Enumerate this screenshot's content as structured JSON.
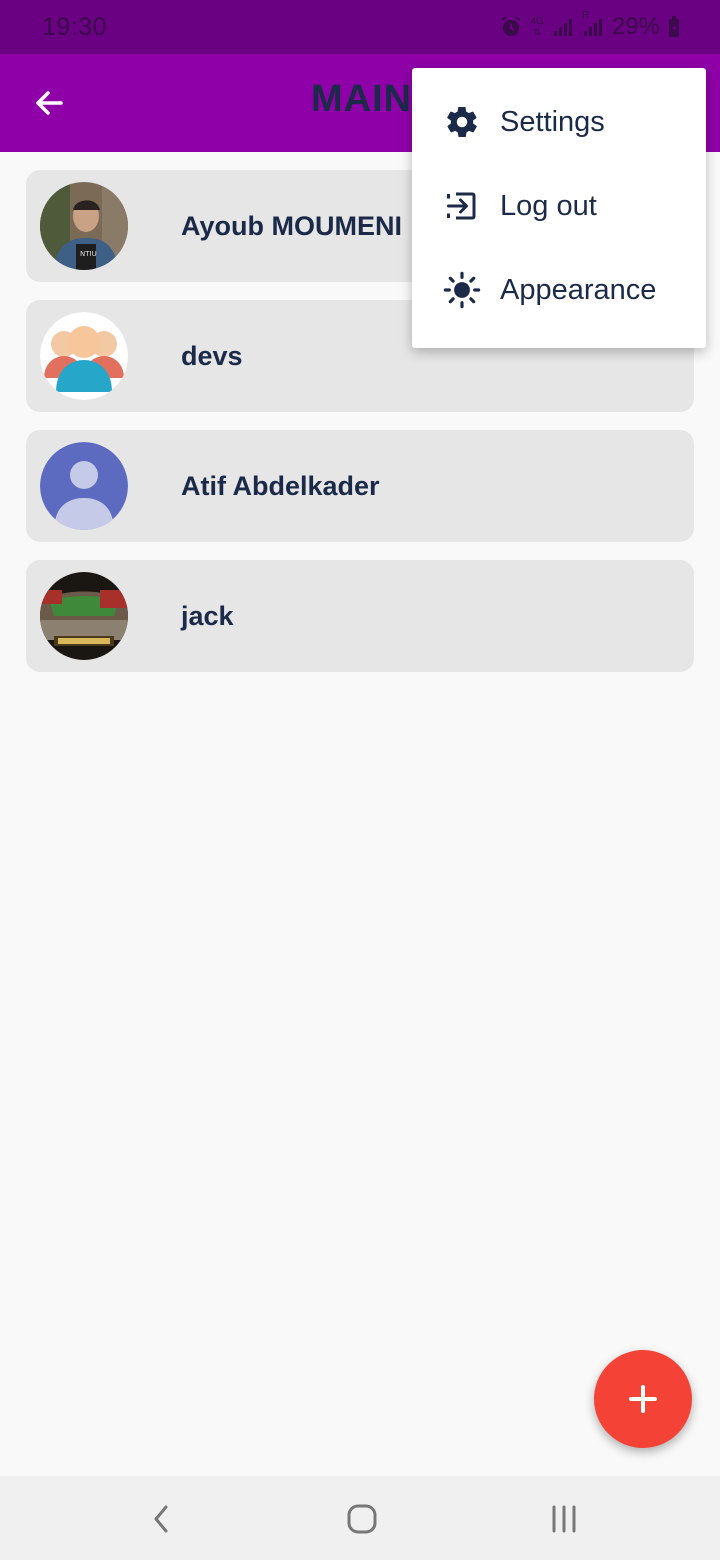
{
  "status_bar": {
    "time": "19:30",
    "network": "4G",
    "roaming": "R",
    "battery": "29%",
    "icons": [
      "alarm-icon",
      "network-4g-icon",
      "signal-icon",
      "signal-roaming-icon",
      "battery-charging-icon"
    ]
  },
  "app_bar": {
    "title": "MAIN",
    "back_icon": "arrow-back-icon"
  },
  "chats": [
    {
      "name": "Ayoub MOUMENI",
      "avatar": "photo-avatar"
    },
    {
      "name": "devs",
      "avatar": "group-avatar"
    },
    {
      "name": "Atif Abdelkader",
      "avatar": "default-person-avatar"
    },
    {
      "name": "jack",
      "avatar": "stadium-photo-avatar"
    }
  ],
  "menu": {
    "items": [
      {
        "label": "Settings",
        "icon": "gear-icon"
      },
      {
        "label": "Log out",
        "icon": "logout-icon"
      },
      {
        "label": "Appearance",
        "icon": "sun-icon"
      }
    ]
  },
  "fab": {
    "icon": "plus-icon"
  },
  "nav_bar": {
    "icons": [
      "nav-back-icon",
      "nav-home-icon",
      "nav-recents-icon"
    ]
  },
  "colors": {
    "status_bar": "#6a0082",
    "app_bar": "#8f00a8",
    "fab": "#f44336",
    "text": "#1c2a4a",
    "row_bg": "#e6e6e6"
  }
}
